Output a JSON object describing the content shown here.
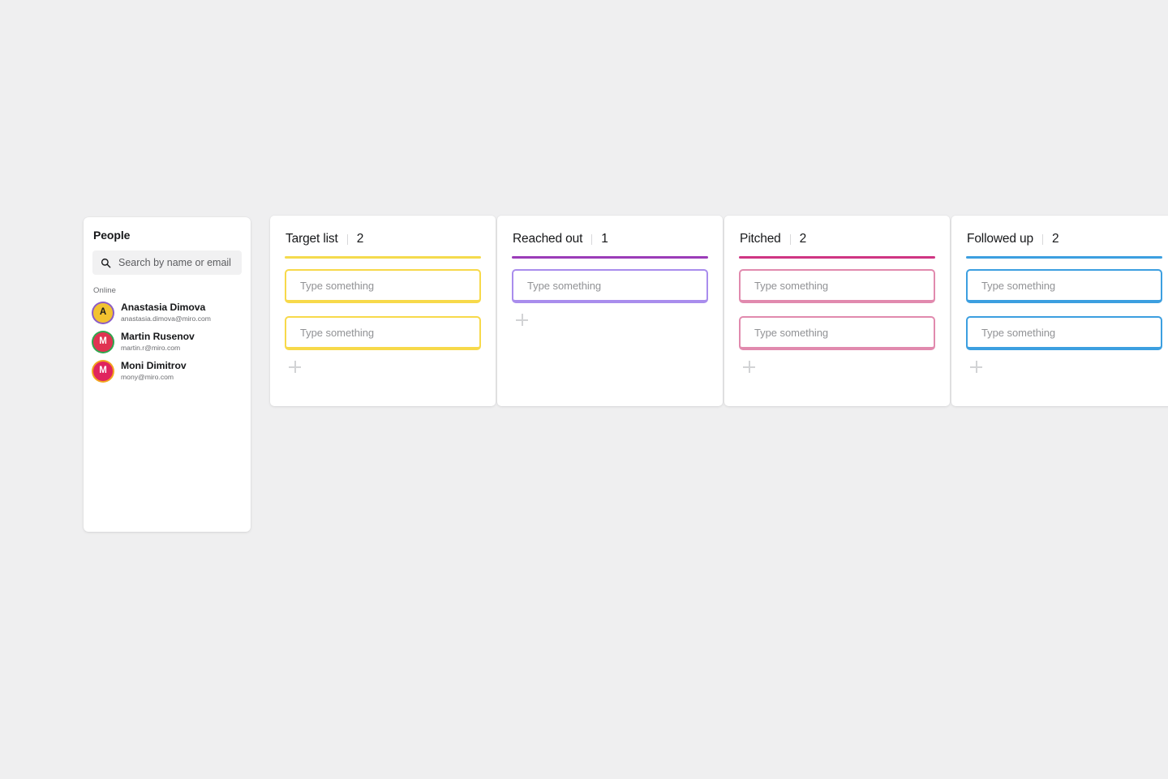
{
  "people_panel": {
    "title": "People",
    "search": {
      "placeholder": "Search by name or email",
      "value": "",
      "icon": "search-icon"
    },
    "section_label": "Online",
    "members": [
      {
        "initial": "A",
        "name": "Anastasia Dimova",
        "email": "anastasia.dimova@miro.com",
        "avatar_bg": "#f2c230",
        "avatar_fg": "#17181a",
        "ring": "#8b5cc7"
      },
      {
        "initial": "M",
        "name": "Martin Rusenov",
        "email": "martin.r@miro.com",
        "avatar_bg": "#e03252",
        "avatar_fg": "#ffffff",
        "ring": "#2fa84f"
      },
      {
        "initial": "M",
        "name": "Moni Dimitrov",
        "email": "mony@miro.com",
        "avatar_bg": "#e0245e",
        "avatar_fg": "#ffffff",
        "ring": "#f2a61e"
      }
    ]
  },
  "board": {
    "card_placeholder": "Type something",
    "add_label": "+",
    "columns": [
      {
        "title": "Target list",
        "count": "2",
        "rule_color": "#f5db4e",
        "card_border": "#f7d94a",
        "cards": [
          {
            "placeholder": "Type something",
            "value": ""
          },
          {
            "placeholder": "Type something",
            "value": ""
          }
        ]
      },
      {
        "title": "Reached out",
        "count": "1",
        "rule_color": "#9b3cb8",
        "card_border": "#a98ded",
        "cards": [
          {
            "placeholder": "Type something",
            "value": ""
          }
        ]
      },
      {
        "title": "Pitched",
        "count": "2",
        "rule_color": "#cf3583",
        "card_border": "#e18aae",
        "cards": [
          {
            "placeholder": "Type something",
            "value": ""
          },
          {
            "placeholder": "Type something",
            "value": ""
          }
        ]
      },
      {
        "title": "Followed up",
        "count": "2",
        "rule_color": "#3c9fe0",
        "card_border": "#3c9fe0",
        "cards": [
          {
            "placeholder": "Type something",
            "value": ""
          },
          {
            "placeholder": "Type something",
            "value": ""
          }
        ]
      }
    ]
  }
}
